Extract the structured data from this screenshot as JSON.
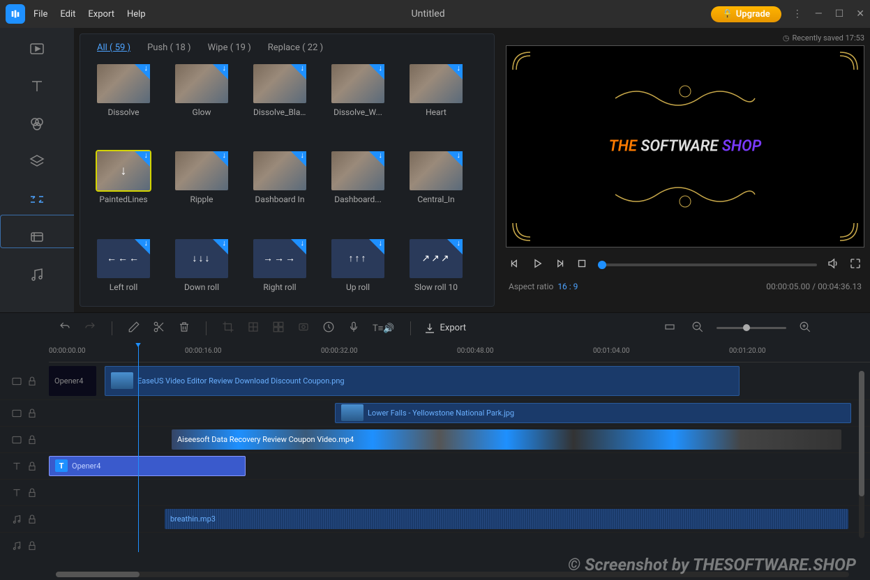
{
  "titlebar": {
    "menu": [
      "File",
      "Edit",
      "Export",
      "Help"
    ],
    "title": "Untitled",
    "upgrade": "Upgrade"
  },
  "saved_status": "Recently saved 17:53",
  "panel_tabs": [
    {
      "label": "All ( 59 )",
      "active": true
    },
    {
      "label": "Push ( 18 )",
      "active": false
    },
    {
      "label": "Wipe ( 19 )",
      "active": false
    },
    {
      "label": "Replace ( 22 )",
      "active": false
    }
  ],
  "transitions": [
    {
      "label": "Dissolve",
      "type": "img"
    },
    {
      "label": "Glow",
      "type": "img"
    },
    {
      "label": "Dissolve_Bla...",
      "type": "img"
    },
    {
      "label": "Dissolve_W...",
      "type": "img"
    },
    {
      "label": "Heart",
      "type": "img"
    },
    {
      "label": "PaintedLines",
      "type": "img",
      "selected": true,
      "center_icon": "↓"
    },
    {
      "label": "Ripple",
      "type": "img"
    },
    {
      "label": "Dashboard In",
      "type": "img"
    },
    {
      "label": "Dashboard...",
      "type": "img"
    },
    {
      "label": "Central_In",
      "type": "img"
    },
    {
      "label": "Left roll",
      "type": "dark",
      "arrows": "←←←"
    },
    {
      "label": "Down roll",
      "type": "dark",
      "arrows": "↓↓↓"
    },
    {
      "label": "Right roll",
      "type": "dark",
      "arrows": "→→→"
    },
    {
      "label": "Up roll",
      "type": "dark",
      "arrows": "↑↑↑"
    },
    {
      "label": "Slow roll 10",
      "type": "dark",
      "arrows": "↗↗↗"
    }
  ],
  "preview": {
    "text1": "THE ",
    "text2": "SOFTWARE ",
    "text3": "SHOP",
    "aspect_label": "Aspect ratio",
    "aspect_value": "16 : 9",
    "time": "00:00:05.00 / 00:04:36.13"
  },
  "toolbar": {
    "export": "Export"
  },
  "timeline": {
    "ticks": [
      {
        "label": "00:00:00.00",
        "pos": 0
      },
      {
        "label": "00:00:16.00",
        "pos": 195
      },
      {
        "label": "00:00:32.00",
        "pos": 390
      },
      {
        "label": "00:00:48.00",
        "pos": 585
      },
      {
        "label": "00:01:04.00",
        "pos": 780
      },
      {
        "label": "00:01:20.00",
        "pos": 975
      }
    ],
    "clips": {
      "opener_label": "Opener4",
      "png_label": "EaseUS Video Editor Review Download Discount Coupon.png",
      "jpg_label": "Lower Falls - Yellowstone National Park.jpg",
      "mp4_label": "Aiseesoft Data Recovery Review Coupon Video.mp4",
      "text_label": "Opener4",
      "audio_label": "breathin.mp3"
    }
  },
  "watermark": "© Screenshot by THESOFTWARE.SHOP"
}
